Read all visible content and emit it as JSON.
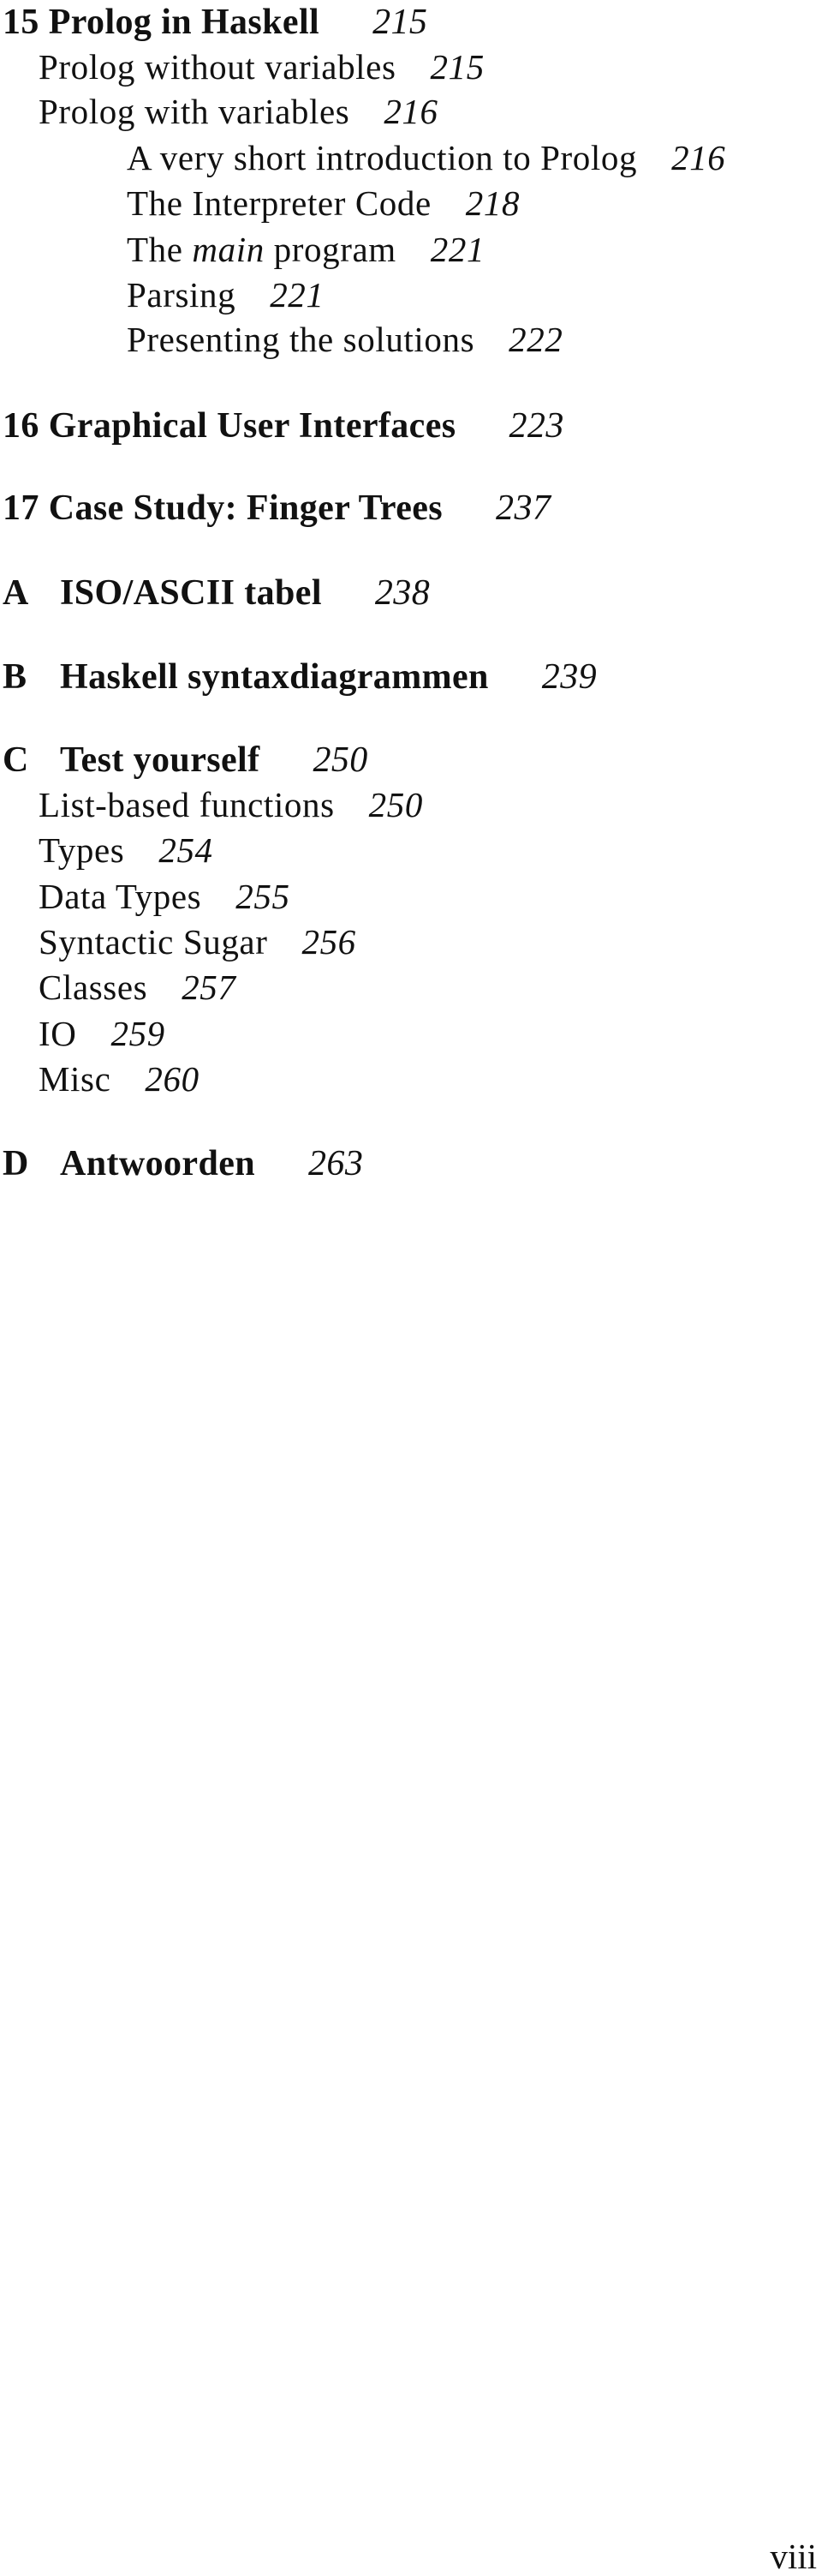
{
  "toc": {
    "ch15": {
      "number": "15",
      "title": "Prolog in Haskell",
      "page": "215",
      "sections": [
        {
          "title": "Prolog without variables",
          "page": "215"
        },
        {
          "title": "Prolog with variables",
          "page": "216"
        }
      ],
      "subsections": [
        {
          "title": "A very short introduction to Prolog",
          "page": "216"
        },
        {
          "title": "The Interpreter Code",
          "page": "218"
        },
        {
          "title_pre": "The ",
          "title_em": "main",
          "title_post": " program",
          "page": "221"
        },
        {
          "title": "Parsing",
          "page": "221"
        },
        {
          "title": "Presenting the solutions",
          "page": "222"
        }
      ]
    },
    "ch16": {
      "number": "16",
      "title": "Graphical User Interfaces",
      "page": "223"
    },
    "ch17": {
      "number": "17",
      "title": "Case Study: Finger Trees",
      "page": "237"
    },
    "appA": {
      "letter": "A",
      "title": "ISO/ASCII tabel",
      "page": "238"
    },
    "appB": {
      "letter": "B",
      "title": "Haskell syntaxdiagrammen",
      "page": "239"
    },
    "appC": {
      "letter": "C",
      "title": "Test yourself",
      "page": "250",
      "sections": [
        {
          "title": "List-based functions",
          "page": "250"
        },
        {
          "title": "Types",
          "page": "254"
        },
        {
          "title": "Data Types",
          "page": "255"
        },
        {
          "title": "Syntactic Sugar",
          "page": "256"
        },
        {
          "title": "Classes",
          "page": "257"
        },
        {
          "title": "IO",
          "page": "259"
        },
        {
          "title": "Misc",
          "page": "260"
        }
      ]
    },
    "appD": {
      "letter": "D",
      "title": "Antwoorden",
      "page": "263"
    }
  },
  "folio": "viii"
}
